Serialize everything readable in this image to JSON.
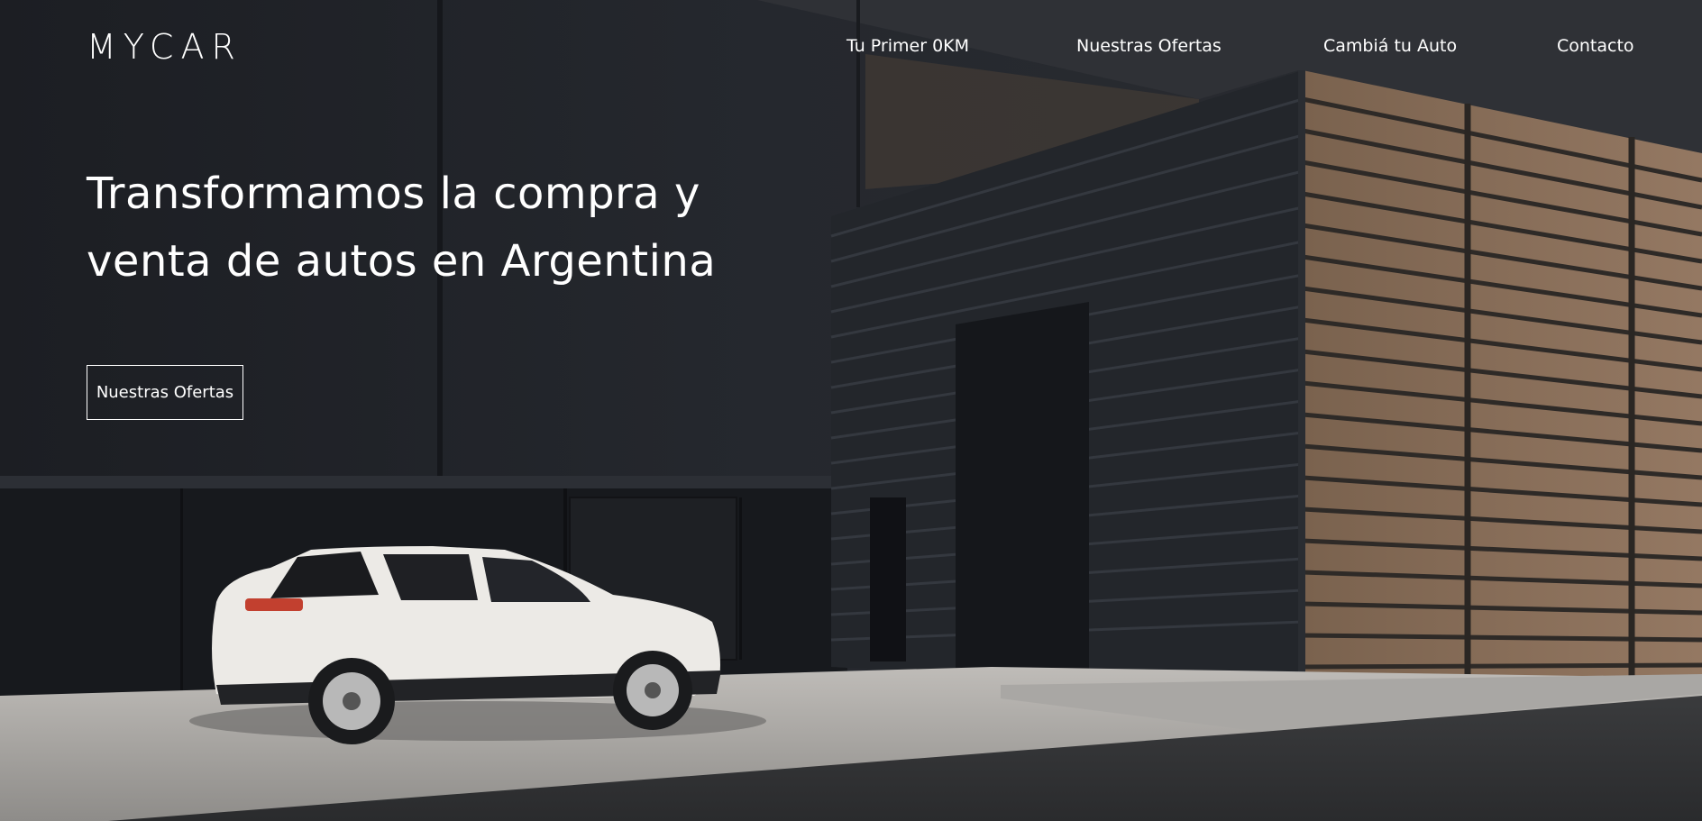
{
  "header": {
    "brand": "MYCAR",
    "nav": [
      {
        "label": "Tu Primer 0KM"
      },
      {
        "label": "Nuestras Ofertas"
      },
      {
        "label": "Cambiá tu Auto"
      },
      {
        "label": "Contacto"
      }
    ]
  },
  "hero": {
    "headline_line1": "Transformamos la compra y",
    "headline_line2": "venta de autos en Argentina",
    "cta_label": "Nuestras Ofertas"
  },
  "colors": {
    "text": "#ffffff",
    "background": "#1b1d22",
    "wood": "#8a6d55",
    "car_body": "#eceae6"
  }
}
